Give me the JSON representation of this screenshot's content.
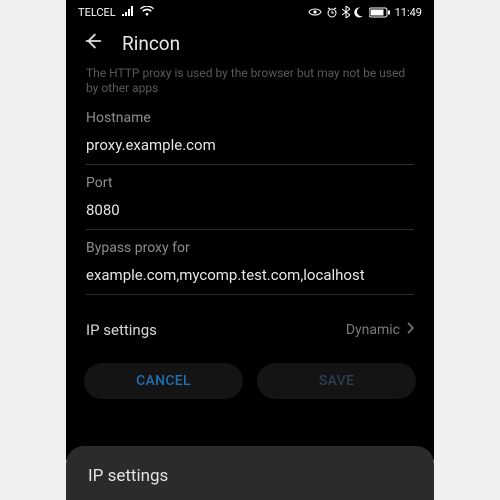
{
  "statusbar": {
    "carrier": "TELCEL",
    "time": "11:49"
  },
  "header": {
    "title": "Rincon"
  },
  "helper": "The HTTP proxy is used by the browser but may not be used by other apps",
  "hostname": {
    "label": "Hostname",
    "value": "proxy.example.com"
  },
  "port": {
    "label": "Port",
    "value": "8080"
  },
  "bypass": {
    "label": "Bypass proxy for",
    "value": "example.com,mycomp.test.com,localhost"
  },
  "ip_settings_row": {
    "label": "IP settings",
    "value": "Dynamic"
  },
  "buttons": {
    "cancel": "CANCEL",
    "save": "SAVE"
  },
  "sheet": {
    "title": "IP settings"
  }
}
